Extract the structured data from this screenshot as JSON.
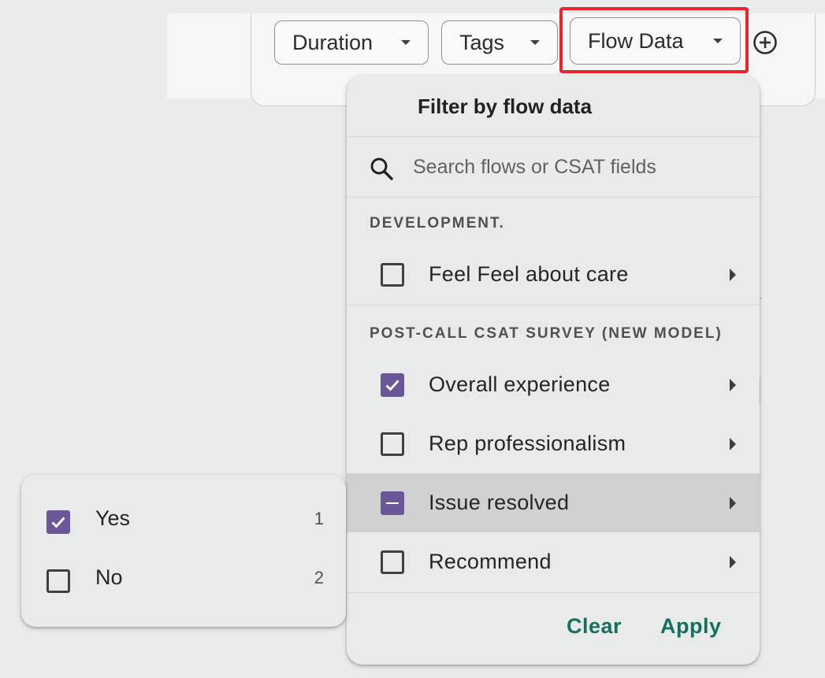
{
  "toolbar": {
    "chips": [
      {
        "label": "Duration"
      },
      {
        "label": "Tags"
      },
      {
        "label": "Flow Data"
      }
    ]
  },
  "flow_menu": {
    "title": "Filter by flow data",
    "search": {
      "placeholder": "Search flows or CSAT fields",
      "value": ""
    },
    "sections": [
      {
        "label": "DEVELOPMENT.",
        "items": [
          {
            "label": "Feel Feel about care",
            "state": "unchecked"
          }
        ]
      },
      {
        "label": "POST-CALL CSAT SURVEY (NEW MODEL)",
        "items": [
          {
            "label": "Overall experience",
            "state": "checked"
          },
          {
            "label": "Rep professionalism",
            "state": "unchecked"
          },
          {
            "label": "Issue resolved",
            "state": "partial"
          },
          {
            "label": "Recommend",
            "state": "unchecked"
          }
        ]
      }
    ],
    "clear_label": "Clear",
    "apply_label": "Apply"
  },
  "submenu": {
    "options": [
      {
        "label": "Yes",
        "count": "1",
        "state": "checked"
      },
      {
        "label": "No",
        "count": "2",
        "state": "unchecked"
      }
    ]
  },
  "colors": {
    "accent": "#6b5797",
    "action_text": "#17705e",
    "highlight_border": "#e8252b",
    "hover_row": "#cfd2d0"
  },
  "icons": [
    "add-circle-icon",
    "search-icon",
    "caret-down-icon",
    "caret-right-icon",
    "check-icon",
    "dash-icon"
  ]
}
